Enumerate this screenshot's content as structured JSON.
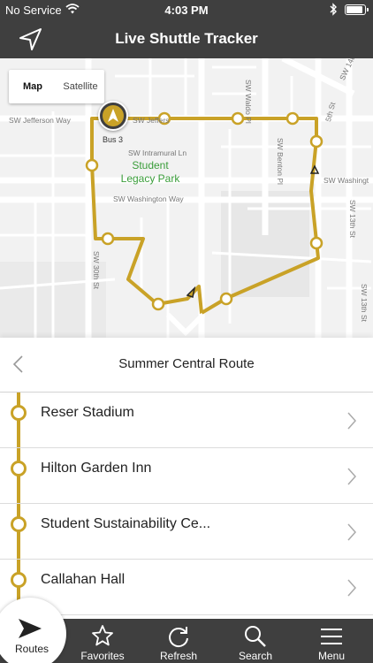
{
  "status_bar": {
    "carrier": "No Service",
    "time": "4:03 PM"
  },
  "nav": {
    "title": "Live Shuttle Tracker",
    "location_icon": "location-arrow-icon"
  },
  "map": {
    "toggle": {
      "map_label": "Map",
      "satellite_label": "Satellite",
      "selected": "Map"
    },
    "park_label": "Student Legacy Park",
    "bus_label": "Bus 3",
    "streets": {
      "jefferson_left": "SW Jefferson Way",
      "jefferson_right": "SW Jeffers",
      "intramural": "SW Intramural Ln",
      "washington_left": "SW Washington Way",
      "washington_right": "SW Washingt",
      "waldo": "SW Waldo Pl",
      "benton": "SW Benton Pl",
      "thirtieth": "SW 30th St",
      "thirteenth_a": "SW 13th St",
      "thirteenth_b": "SW 13th St",
      "fourteenth": "SW 14th",
      "fifteenth": "5th St"
    },
    "route_color": "#c9a227"
  },
  "route": {
    "name": "Summer Central Route",
    "stops": [
      {
        "label": "Reser Stadium"
      },
      {
        "label": "Hilton Garden Inn"
      },
      {
        "label": "Student Sustainability Ce..."
      },
      {
        "label": "Callahan Hall"
      }
    ]
  },
  "tabs": [
    {
      "label": "Routes",
      "icon": "routes-arrow-icon",
      "active": true
    },
    {
      "label": "Favorites",
      "icon": "star-icon"
    },
    {
      "label": "Refresh",
      "icon": "refresh-icon"
    },
    {
      "label": "Search",
      "icon": "search-icon"
    },
    {
      "label": "Menu",
      "icon": "hamburger-menu-icon"
    }
  ],
  "colors": {
    "bar_background": "#3f3f3f",
    "accent": "#c9a227"
  }
}
